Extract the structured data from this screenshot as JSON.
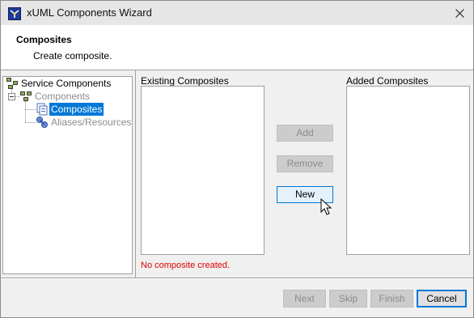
{
  "window": {
    "title": "xUML Components Wizard"
  },
  "header": {
    "title": "Composites",
    "subtitle": "Create composite."
  },
  "tree": {
    "items": [
      {
        "label": "Service Components"
      },
      {
        "label": "Components"
      },
      {
        "label": "Composites"
      },
      {
        "label": "Aliases/Resources"
      }
    ]
  },
  "existing": {
    "label": "Existing Composites"
  },
  "added": {
    "label": "Added Composites"
  },
  "buttons": {
    "add": "Add",
    "remove": "Remove",
    "new": "New"
  },
  "status": {
    "message": "No composite created."
  },
  "footer": {
    "next": "Next",
    "skip": "Skip",
    "finish": "Finish",
    "cancel": "Cancel"
  },
  "colors": {
    "accent": "#0078d7",
    "error": "#e00000",
    "disabled_text": "#8c8c8c"
  },
  "icons": [
    "wizard-app-icon",
    "close-icon",
    "service-components-icon",
    "components-icon",
    "composites-icon",
    "aliases-resources-icon",
    "mouse-cursor-icon"
  ]
}
